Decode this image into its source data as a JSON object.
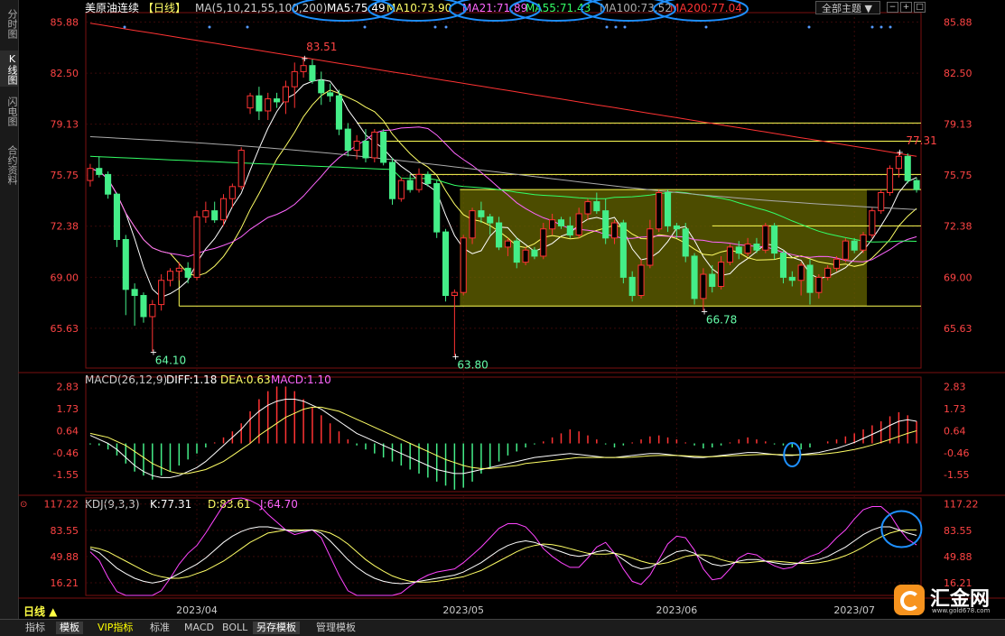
{
  "sidebar": [
    {
      "label": "分时图",
      "active": false
    },
    {
      "label": "K线图",
      "active": true
    },
    {
      "label": "闪电图",
      "active": false
    },
    {
      "label": "合约资料",
      "active": false
    }
  ],
  "header": {
    "symbol": "美原油连续",
    "period": "【日线】",
    "ma_title": "MA(5,10,21,55,100,200)",
    "ma": [
      {
        "label": "MA5:75.49",
        "color": "#ffffff"
      },
      {
        "label": "MA10:73.90",
        "color": "#ffff66"
      },
      {
        "label": "MA21:71.89",
        "color": "#ff66ff"
      },
      {
        "label": "MA55:71.43",
        "color": "#33ff66"
      },
      {
        "label": "MA100:73.52",
        "color": "#aaaaaa"
      },
      {
        "label": "MA200:77.04",
        "color": "#ff3333"
      }
    ],
    "theme_button": "全部主题",
    "theme_arrow": "▼"
  },
  "colors": {
    "up": "#ff3333",
    "down": "#44ee88",
    "ma5": "#ffffff",
    "ma10": "#ffff66",
    "ma21": "#ff66ff",
    "ma55": "#33ff66",
    "ma100": "#aaaaaa",
    "ma200": "#ff3333",
    "box": "#666600",
    "circle": "#1e90ff"
  },
  "chart_data": [
    {
      "type": "candlestick",
      "title": "",
      "price_ticks": [
        85.88,
        82.5,
        79.13,
        75.75,
        72.38,
        69.0,
        65.63
      ],
      "ylim": [
        63.0,
        86.5
      ],
      "x_labels": [
        "2023/04",
        "2023/05",
        "2023/06",
        "2023/07"
      ],
      "annotations": [
        {
          "text": "83.51",
          "value": 83.51,
          "kind": "high"
        },
        {
          "text": "64.10",
          "value": 64.1,
          "kind": "low"
        },
        {
          "text": "63.80",
          "value": 63.8,
          "kind": "low"
        },
        {
          "text": "66.78",
          "value": 66.78,
          "kind": "low"
        },
        {
          "text": "77.31",
          "value": 77.31,
          "kind": "high"
        }
      ],
      "horizontal_levels": [
        79.2,
        78.0,
        75.8,
        74.8,
        72.4,
        67.1
      ],
      "range_box": {
        "from_price": 67.1,
        "to_price": 74.8
      },
      "candles_ohlc": [
        [
          75.4,
          76.5,
          75.0,
          76.2
        ],
        [
          76.2,
          77.0,
          75.6,
          75.8
        ],
        [
          75.8,
          76.0,
          74.2,
          74.5
        ],
        [
          74.5,
          74.6,
          71.0,
          71.5
        ],
        [
          71.5,
          71.8,
          66.5,
          68.2
        ],
        [
          68.2,
          68.6,
          65.8,
          67.8
        ],
        [
          67.8,
          68.0,
          66.0,
          66.4
        ],
        [
          66.4,
          67.5,
          64.1,
          67.2
        ],
        [
          67.2,
          69.2,
          66.8,
          68.8
        ],
        [
          68.8,
          69.6,
          68.4,
          69.4
        ],
        [
          69.4,
          70.0,
          68.8,
          69.6
        ],
        [
          69.6,
          70.0,
          68.6,
          69.0
        ],
        [
          69.0,
          73.4,
          68.8,
          73.0
        ],
        [
          73.0,
          74.0,
          72.6,
          73.4
        ],
        [
          73.4,
          74.0,
          72.6,
          72.8
        ],
        [
          72.8,
          74.5,
          72.4,
          74.2
        ],
        [
          74.2,
          75.2,
          73.6,
          75.0
        ],
        [
          75.0,
          77.6,
          74.8,
          77.4
        ],
        [
          80.2,
          81.2,
          79.8,
          81.0
        ],
        [
          81.0,
          81.6,
          79.4,
          80.0
        ],
        [
          80.0,
          81.2,
          79.4,
          80.8
        ],
        [
          80.8,
          81.2,
          80.2,
          80.6
        ],
        [
          80.6,
          82.0,
          79.8,
          81.6
        ],
        [
          81.6,
          83.2,
          80.2,
          82.6
        ],
        [
          82.6,
          83.51,
          82.2,
          83.0
        ],
        [
          83.0,
          83.4,
          81.8,
          82.0
        ],
        [
          82.0,
          82.6,
          80.4,
          81.2
        ],
        [
          81.2,
          81.8,
          80.6,
          81.0
        ],
        [
          81.0,
          81.4,
          78.4,
          78.8
        ],
        [
          78.8,
          79.2,
          77.0,
          77.4
        ],
        [
          77.4,
          78.4,
          76.8,
          78.0
        ],
        [
          78.0,
          78.8,
          76.6,
          76.9
        ],
        [
          76.9,
          78.8,
          76.6,
          78.6
        ],
        [
          78.6,
          78.8,
          76.4,
          76.6
        ],
        [
          76.6,
          76.9,
          73.8,
          74.2
        ],
        [
          74.2,
          75.6,
          74.0,
          75.4
        ],
        [
          75.4,
          75.8,
          74.6,
          74.8
        ],
        [
          74.8,
          76.2,
          74.6,
          75.8
        ],
        [
          75.8,
          76.0,
          75.0,
          75.2
        ],
        [
          75.2,
          75.4,
          71.6,
          72.0
        ],
        [
          72.0,
          72.2,
          67.4,
          67.8
        ],
        [
          67.8,
          68.2,
          63.8,
          68.0
        ],
        [
          68.0,
          71.8,
          67.8,
          71.6
        ],
        [
          71.6,
          73.6,
          71.2,
          73.4
        ],
        [
          73.4,
          74.0,
          72.6,
          73.0
        ],
        [
          73.0,
          73.2,
          71.8,
          72.6
        ],
        [
          72.6,
          73.0,
          70.8,
          71.0
        ],
        [
          71.0,
          71.6,
          70.4,
          71.4
        ],
        [
          71.4,
          71.6,
          69.6,
          70.0
        ],
        [
          70.0,
          71.0,
          69.8,
          70.8
        ],
        [
          70.8,
          71.0,
          70.2,
          70.4
        ],
        [
          70.4,
          72.6,
          70.2,
          72.2
        ],
        [
          72.2,
          73.2,
          71.8,
          72.8
        ],
        [
          72.8,
          73.0,
          72.2,
          72.4
        ],
        [
          72.4,
          73.0,
          71.6,
          71.8
        ],
        [
          71.8,
          73.6,
          71.6,
          73.2
        ],
        [
          73.2,
          74.2,
          72.8,
          74.0
        ],
        [
          74.0,
          74.6,
          73.2,
          73.4
        ],
        [
          73.4,
          74.2,
          71.2,
          71.6
        ],
        [
          71.6,
          72.8,
          71.2,
          72.6
        ],
        [
          72.6,
          72.8,
          68.6,
          69.0
        ],
        [
          69.0,
          69.4,
          67.4,
          67.8
        ],
        [
          67.8,
          70.2,
          67.6,
          69.8
        ],
        [
          69.8,
          72.8,
          69.6,
          72.2
        ],
        [
          72.2,
          74.8,
          72.0,
          74.6
        ],
        [
          74.6,
          74.8,
          72.0,
          72.4
        ],
        [
          72.4,
          72.6,
          71.6,
          72.2
        ],
        [
          72.2,
          72.6,
          70.0,
          70.4
        ],
        [
          70.4,
          70.6,
          67.2,
          67.6
        ],
        [
          67.6,
          69.6,
          66.78,
          69.2
        ],
        [
          69.2,
          69.8,
          68.0,
          68.4
        ],
        [
          68.4,
          70.4,
          68.2,
          70.0
        ],
        [
          70.0,
          71.2,
          69.8,
          71.0
        ],
        [
          71.0,
          71.4,
          70.2,
          70.6
        ],
        [
          70.6,
          71.6,
          70.4,
          71.2
        ],
        [
          71.2,
          71.6,
          70.6,
          70.8
        ],
        [
          70.8,
          72.6,
          70.6,
          72.4
        ],
        [
          72.4,
          72.6,
          70.2,
          70.6
        ],
        [
          70.6,
          70.8,
          68.6,
          69.0
        ],
        [
          69.0,
          69.4,
          68.4,
          68.8
        ],
        [
          68.8,
          70.0,
          67.8,
          69.8
        ],
        [
          69.8,
          70.2,
          67.2,
          68.0
        ],
        [
          68.0,
          69.2,
          67.6,
          69.0
        ],
        [
          69.0,
          69.8,
          68.8,
          69.6
        ],
        [
          69.6,
          70.4,
          69.4,
          70.2
        ],
        [
          70.2,
          71.6,
          70.0,
          71.4
        ],
        [
          71.4,
          71.6,
          70.6,
          70.8
        ],
        [
          70.8,
          72.0,
          70.6,
          71.8
        ],
        [
          71.8,
          73.6,
          71.6,
          73.4
        ],
        [
          73.4,
          74.8,
          73.2,
          74.6
        ],
        [
          74.6,
          76.4,
          74.4,
          76.2
        ],
        [
          76.2,
          77.31,
          75.6,
          77.0
        ],
        [
          77.0,
          77.2,
          75.2,
          75.4
        ],
        [
          75.4,
          75.6,
          74.6,
          74.8
        ]
      ],
      "ma_periods": [
        5,
        10,
        21,
        55,
        100,
        200
      ]
    },
    {
      "type": "macd",
      "title": "MACD(26,12,9)",
      "values_text": [
        {
          "label": "DIFF:1.18",
          "color": "#ffffff"
        },
        {
          "label": "DEA:0.63",
          "color": "#ffff66"
        },
        {
          "label": "MACD:1.10",
          "color": "#ff66ff"
        }
      ],
      "ticks": [
        2.83,
        1.73,
        0.64,
        -0.46,
        -1.55
      ],
      "ylim": [
        -2.4,
        3.3
      ],
      "hist": [
        -0.05,
        -0.1,
        -0.3,
        -0.6,
        -1.0,
        -1.4,
        -1.6,
        -1.8,
        -1.6,
        -1.4,
        -1.1,
        -0.8,
        -0.5,
        -0.2,
        0.05,
        0.3,
        0.6,
        1.0,
        1.6,
        2.2,
        2.6,
        2.83,
        2.83,
        2.6,
        2.2,
        1.8,
        1.4,
        1.0,
        0.6,
        0.2,
        -0.1,
        -0.3,
        -0.5,
        -0.7,
        -0.9,
        -1.1,
        -1.3,
        -1.5,
        -1.7,
        -1.9,
        -2.1,
        -2.3,
        -2.2,
        -1.9,
        -1.5,
        -1.2,
        -0.9,
        -0.6,
        -0.4,
        -0.2,
        -0.05,
        0.1,
        0.3,
        0.5,
        0.7,
        0.6,
        0.4,
        0.2,
        -0.05,
        -0.2,
        -0.1,
        0.05,
        0.2,
        0.35,
        0.4,
        0.3,
        0.2,
        0.05,
        -0.1,
        -0.25,
        -0.2,
        -0.1,
        0.05,
        0.2,
        0.3,
        0.2,
        0.1,
        -0.05,
        -0.1,
        -0.2,
        -0.3,
        -0.2,
        0.0,
        0.1,
        0.2,
        0.35,
        0.5,
        0.7,
        0.9,
        1.1,
        1.35,
        1.55,
        1.4,
        1.1
      ],
      "diff": [
        0.4,
        0.2,
        0.0,
        -0.3,
        -0.7,
        -1.1,
        -1.4,
        -1.6,
        -1.7,
        -1.7,
        -1.6,
        -1.4,
        -1.2,
        -0.9,
        -0.5,
        -0.1,
        0.3,
        0.7,
        1.2,
        1.6,
        1.9,
        2.1,
        2.2,
        2.2,
        2.1,
        1.9,
        1.7,
        1.4,
        1.1,
        0.8,
        0.5,
        0.3,
        0.1,
        -0.1,
        -0.3,
        -0.5,
        -0.7,
        -0.9,
        -1.1,
        -1.3,
        -1.4,
        -1.5,
        -1.5,
        -1.4,
        -1.3,
        -1.2,
        -1.1,
        -1.0,
        -0.9,
        -0.8,
        -0.7,
        -0.65,
        -0.6,
        -0.55,
        -0.5,
        -0.55,
        -0.6,
        -0.65,
        -0.7,
        -0.7,
        -0.65,
        -0.6,
        -0.55,
        -0.5,
        -0.5,
        -0.55,
        -0.6,
        -0.65,
        -0.7,
        -0.7,
        -0.65,
        -0.6,
        -0.55,
        -0.5,
        -0.45,
        -0.45,
        -0.5,
        -0.55,
        -0.6,
        -0.6,
        -0.55,
        -0.5,
        -0.45,
        -0.35,
        -0.25,
        -0.1,
        0.05,
        0.25,
        0.45,
        0.65,
        0.9,
        1.1,
        1.18,
        1.1
      ],
      "dea": [
        0.5,
        0.4,
        0.3,
        0.1,
        -0.1,
        -0.4,
        -0.7,
        -1.0,
        -1.2,
        -1.4,
        -1.5,
        -1.5,
        -1.4,
        -1.3,
        -1.1,
        -0.9,
        -0.6,
        -0.3,
        0.0,
        0.4,
        0.7,
        1.0,
        1.3,
        1.5,
        1.7,
        1.8,
        1.8,
        1.7,
        1.6,
        1.4,
        1.2,
        1.0,
        0.8,
        0.6,
        0.4,
        0.2,
        0.0,
        -0.2,
        -0.4,
        -0.6,
        -0.8,
        -0.95,
        -1.1,
        -1.2,
        -1.25,
        -1.25,
        -1.2,
        -1.15,
        -1.1,
        -1.0,
        -0.95,
        -0.9,
        -0.85,
        -0.8,
        -0.75,
        -0.7,
        -0.7,
        -0.7,
        -0.7,
        -0.7,
        -0.7,
        -0.68,
        -0.65,
        -0.62,
        -0.6,
        -0.6,
        -0.6,
        -0.62,
        -0.64,
        -0.66,
        -0.66,
        -0.64,
        -0.62,
        -0.6,
        -0.58,
        -0.56,
        -0.55,
        -0.55,
        -0.56,
        -0.57,
        -0.57,
        -0.56,
        -0.54,
        -0.5,
        -0.45,
        -0.38,
        -0.3,
        -0.2,
        -0.08,
        0.05,
        0.2,
        0.35,
        0.5,
        0.63
      ]
    },
    {
      "type": "kdj",
      "title": "KDJ(9,3,3)",
      "values_text": [
        {
          "label": "K:77.31",
          "color": "#ffffff"
        },
        {
          "label": "D:83.61",
          "color": "#ffff66"
        },
        {
          "label": "J:64.70",
          "color": "#ff66ff"
        }
      ],
      "ticks": [
        117.22,
        83.55,
        49.88,
        16.21
      ],
      "ylim": [
        0,
        125
      ],
      "k": [
        60,
        55,
        45,
        35,
        28,
        22,
        18,
        16,
        18,
        22,
        28,
        34,
        40,
        48,
        58,
        68,
        76,
        82,
        86,
        88,
        88,
        86,
        84,
        82,
        83,
        84,
        80,
        70,
        58,
        46,
        36,
        28,
        22,
        18,
        16,
        15,
        16,
        18,
        20,
        22,
        24,
        26,
        30,
        36,
        42,
        50,
        58,
        64,
        68,
        70,
        68,
        64,
        60,
        56,
        52,
        50,
        52,
        56,
        58,
        54,
        46,
        38,
        34,
        36,
        42,
        50,
        56,
        58,
        54,
        46,
        40,
        38,
        40,
        44,
        46,
        46,
        44,
        42,
        40,
        40,
        42,
        44,
        46,
        50,
        56,
        62,
        70,
        78,
        84,
        88,
        88,
        84,
        80,
        77
      ],
      "d": [
        62,
        60,
        56,
        50,
        44,
        38,
        32,
        27,
        24,
        22,
        22,
        24,
        28,
        32,
        38,
        44,
        52,
        60,
        68,
        74,
        80,
        82,
        84,
        84,
        84,
        84,
        83,
        80,
        74,
        66,
        56,
        46,
        38,
        31,
        25,
        21,
        18,
        17,
        17,
        18,
        20,
        22,
        24,
        28,
        32,
        38,
        44,
        50,
        56,
        61,
        64,
        66,
        65,
        63,
        60,
        57,
        54,
        53,
        53,
        54,
        52,
        48,
        44,
        41,
        40,
        42,
        46,
        50,
        52,
        52,
        50,
        46,
        43,
        42,
        42,
        43,
        44,
        44,
        43,
        42,
        41,
        41,
        42,
        44,
        47,
        51,
        56,
        62,
        69,
        75,
        80,
        83,
        84,
        84
      ],
      "j": [
        56,
        45,
        23,
        5,
        -4,
        -10,
        -10,
        -6,
        6,
        22,
        40,
        54,
        64,
        80,
        98,
        116,
        124,
        126,
        122,
        116,
        104,
        94,
        84,
        78,
        81,
        84,
        74,
        50,
        26,
        6,
        -4,
        -8,
        -10,
        -7,
        -2,
        3,
        12,
        20,
        26,
        30,
        32,
        34,
        42,
        52,
        62,
        74,
        86,
        92,
        92,
        88,
        76,
        60,
        50,
        42,
        36,
        36,
        48,
        62,
        68,
        54,
        34,
        18,
        14,
        26,
        46,
        66,
        76,
        74,
        58,
        34,
        20,
        22,
        34,
        48,
        54,
        52,
        44,
        38,
        34,
        36,
        44,
        50,
        54,
        62,
        74,
        84,
        98,
        110,
        114,
        114,
        104,
        86,
        72,
        64.7
      ]
    }
  ]
}
